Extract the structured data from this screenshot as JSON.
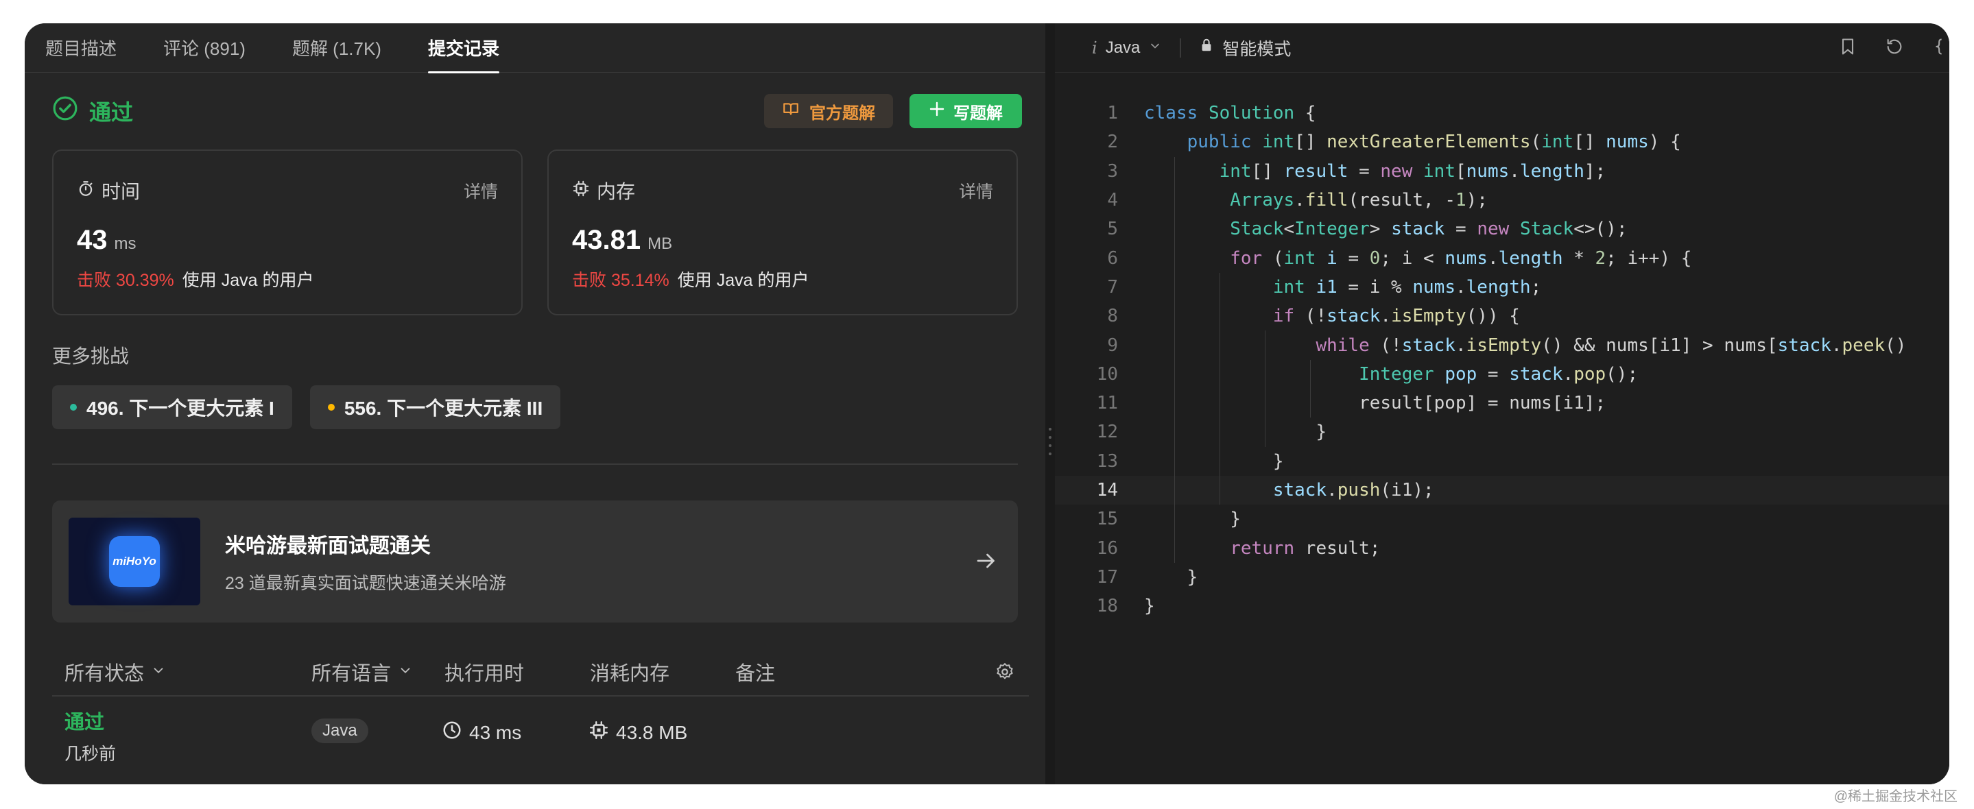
{
  "tabs": [
    {
      "label": "题目描述",
      "active": false
    },
    {
      "label": "评论 (891)",
      "active": false
    },
    {
      "label": "题解 (1.7K)",
      "active": false
    },
    {
      "label": "提交记录",
      "active": true
    }
  ],
  "result": {
    "status": "通过",
    "official_solution_label": "官方题解",
    "write_solution_label": "写题解"
  },
  "runtime": {
    "title": "时间",
    "detail": "详情",
    "value": "43",
    "unit": "ms",
    "beat": "击败 30.39%",
    "beat_suffix": "使用 Java 的用户"
  },
  "memory": {
    "title": "内存",
    "detail": "详情",
    "value": "43.81",
    "unit": "MB",
    "beat": "击败 35.14%",
    "beat_suffix": "使用 Java 的用户"
  },
  "more": {
    "title": "更多挑战",
    "items": [
      {
        "label": "496. 下一个更大元素 I",
        "dot_color": "#2cbb9c"
      },
      {
        "label": "556. 下一个更大元素 III",
        "dot_color": "#ffb800"
      }
    ]
  },
  "promo": {
    "logo_text": "miHoYo",
    "title": "米哈游最新面试题通关",
    "subtitle": "23 道最新真实面试题快速通关米哈游"
  },
  "table": {
    "headers": {
      "status": "所有状态",
      "language": "所有语言",
      "runtime": "执行用时",
      "memory": "消耗内存",
      "notes": "备注"
    },
    "rows": [
      {
        "status": "通过",
        "time": "几秒前",
        "language": "Java",
        "runtime": "43 ms",
        "memory": "43.8 MB"
      }
    ]
  },
  "editor": {
    "language": "Java",
    "mode": "智能模式",
    "current_line": 14,
    "line_numbers": [
      "1",
      "2",
      "3",
      "4",
      "5",
      "6",
      "7",
      "8",
      "9",
      "10",
      "11",
      "12",
      "13",
      "14",
      "15",
      "16",
      "17",
      "18"
    ]
  },
  "watermark": "@稀土掘金技术社区",
  "colors": {
    "accepted": "#2db55d",
    "beat": "#ef4743",
    "official": "#f09a3e",
    "write_button": "#2cb55d"
  }
}
